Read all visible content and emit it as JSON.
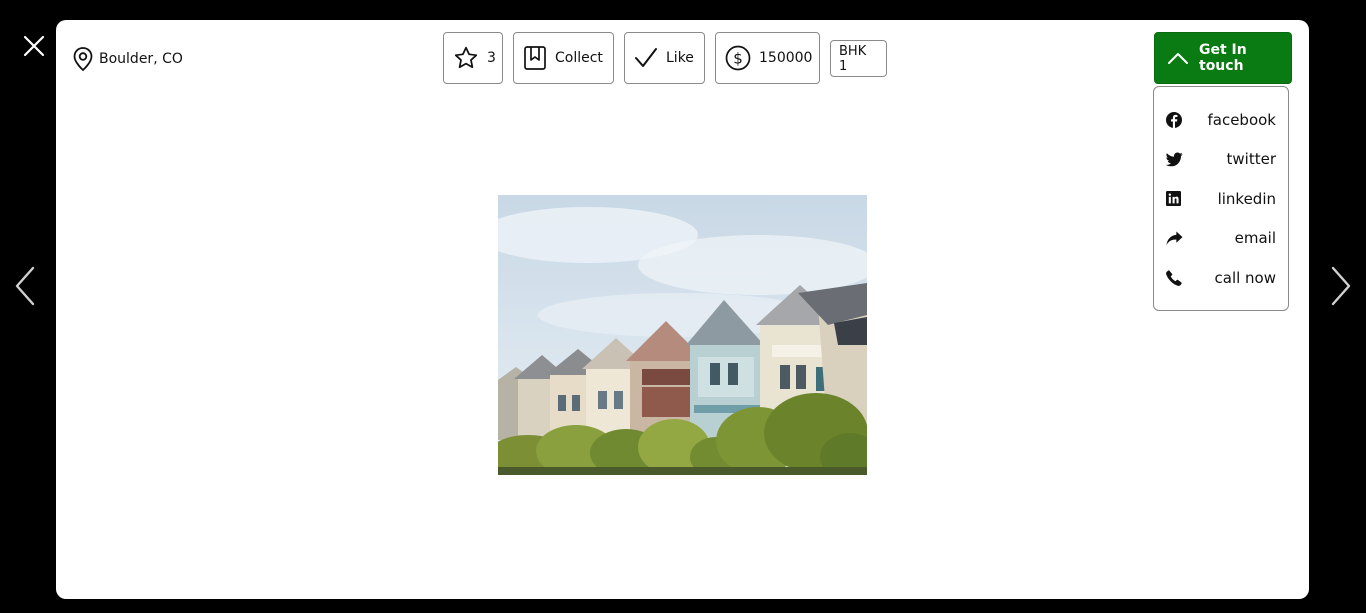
{
  "viewer": {
    "close_icon": "close-icon",
    "prev_icon": "chevron-left-icon",
    "next_icon": "chevron-right-icon"
  },
  "listing": {
    "location": "Boulder, CO",
    "location_icon": "map-pin-icon",
    "photo_icon": "house-photo"
  },
  "actions": {
    "rating": "3",
    "collect_label": "Collect",
    "like_label": "Like",
    "price": "150000",
    "bhk": "BHK 1"
  },
  "contact": {
    "button_label": "Get In touch",
    "accent_color": "#0a7a12",
    "options": [
      {
        "label": "facebook",
        "icon": "facebook-icon"
      },
      {
        "label": "twitter",
        "icon": "twitter-icon"
      },
      {
        "label": "linkedin",
        "icon": "linkedin-icon"
      },
      {
        "label": "email",
        "icon": "share-arrow-icon"
      },
      {
        "label": "call now",
        "icon": "phone-icon"
      }
    ]
  }
}
